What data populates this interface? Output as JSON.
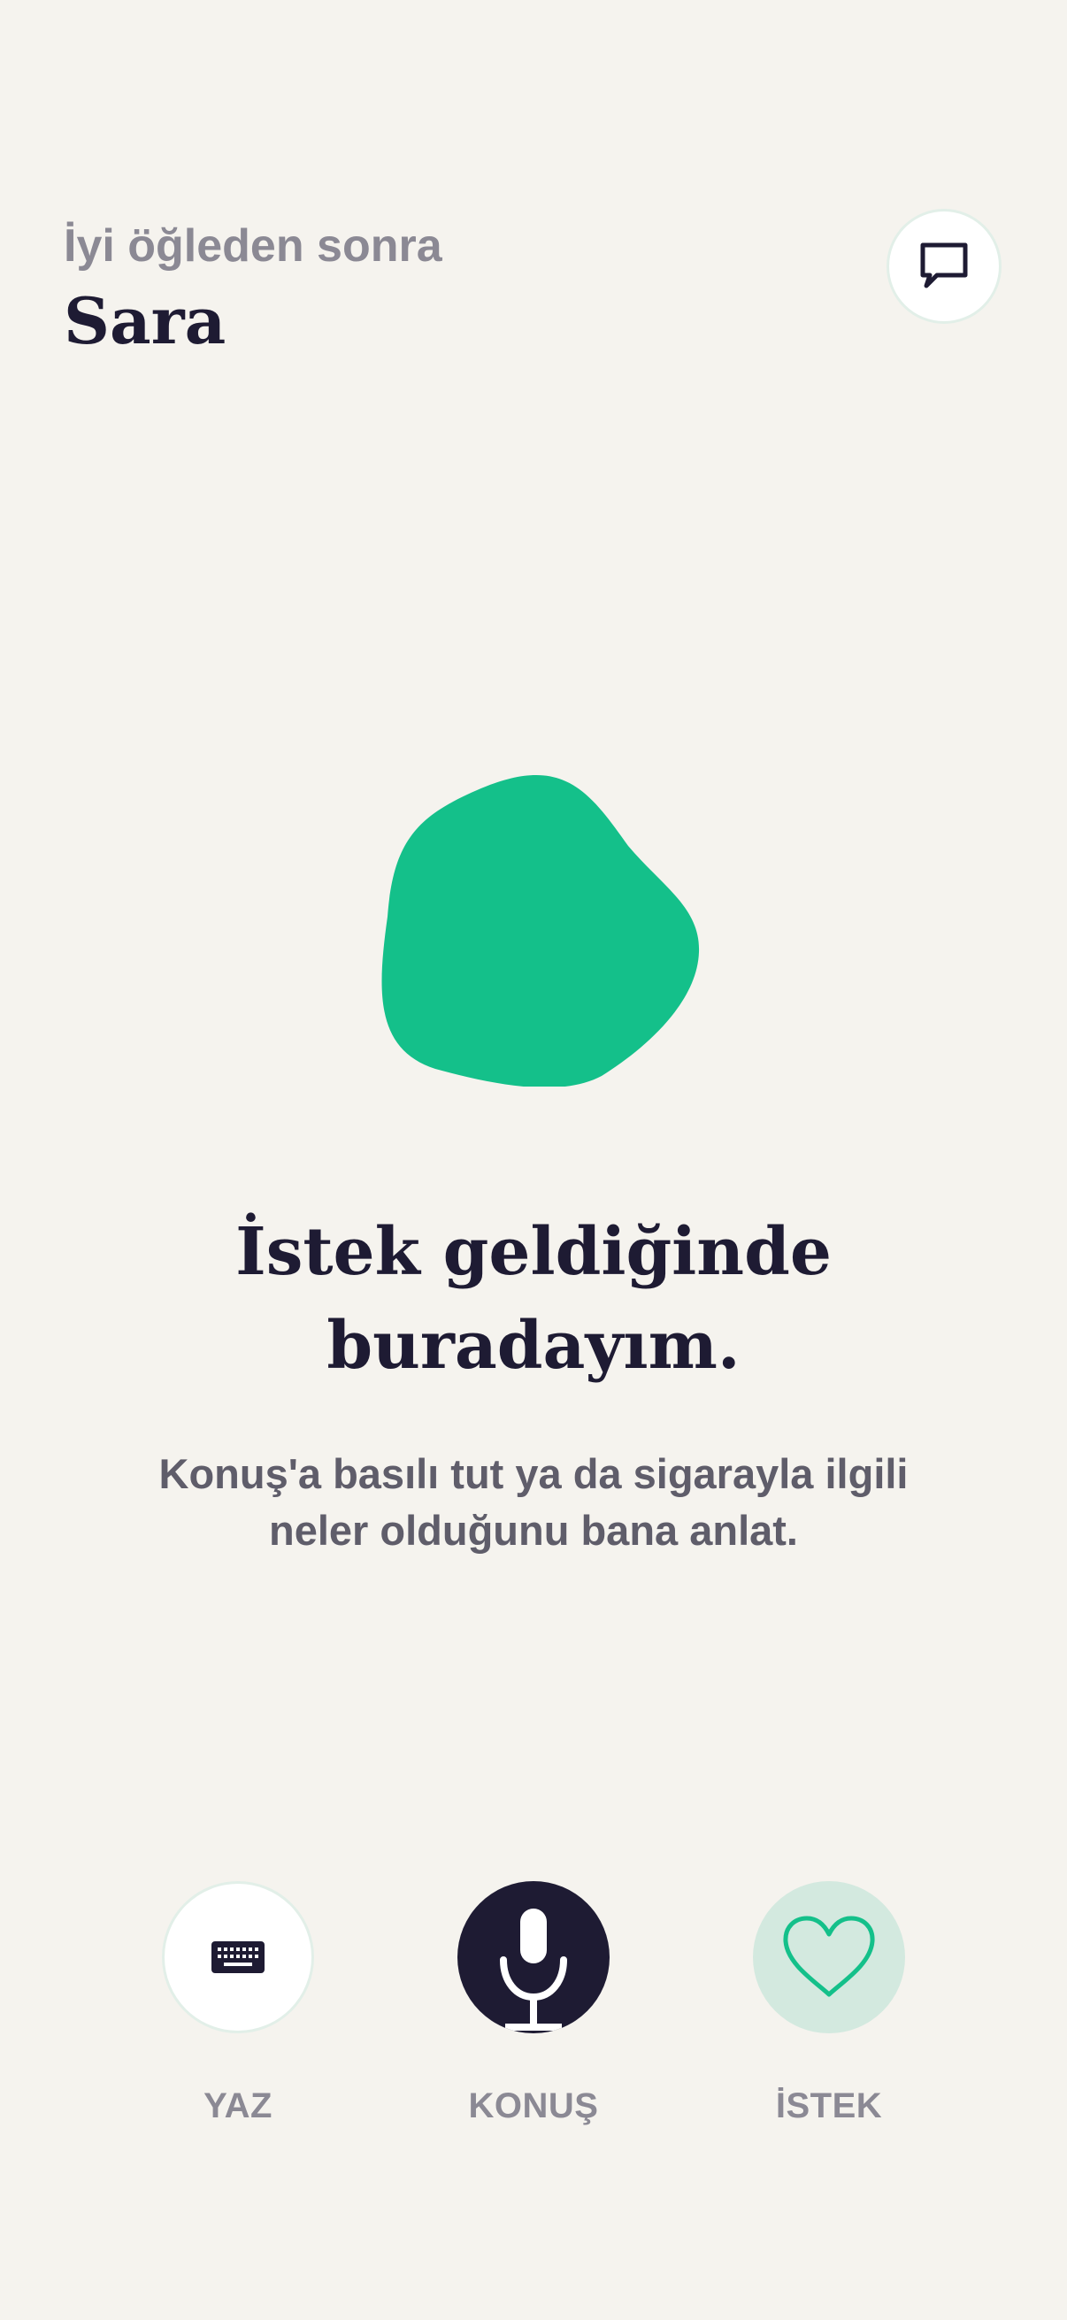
{
  "header": {
    "greeting": "İyi öğleden sonra",
    "user_name": "Sara",
    "chat_icon": "chat-bubble-icon"
  },
  "main": {
    "orb_color": "#14C08A",
    "headline_line1": "İstek geldiğinde",
    "headline_line2": "buradayım.",
    "subtext_line1": "Konuş'a basılı tut ya da sigarayla ilgili",
    "subtext_line2": "neler olduğunu bana anlat."
  },
  "actions": [
    {
      "label": "YAZ",
      "icon": "keyboard-icon"
    },
    {
      "label": "KONUŞ",
      "icon": "microphone-icon"
    },
    {
      "label": "İSTEK",
      "icon": "heart-icon"
    }
  ],
  "colors": {
    "background": "#F5F3EE",
    "primary_dark": "#1E1B33",
    "accent_green": "#14C08A",
    "muted_text": "#8B8994",
    "secondary_text": "#5F5D6A",
    "soft_green": "#D3E9DF"
  }
}
